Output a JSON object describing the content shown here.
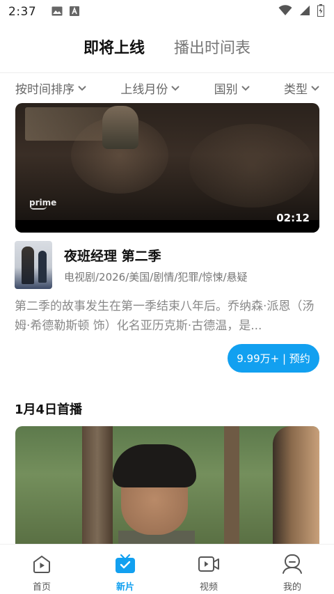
{
  "status_bar": {
    "time": "2:37",
    "icons_left": [
      "image-icon",
      "a-notification-icon"
    ],
    "icons_right": [
      "wifi-icon",
      "signal-icon",
      "battery-icon"
    ]
  },
  "top_tabs": [
    {
      "label": "即将上线",
      "active": true
    },
    {
      "label": "播出时间表",
      "active": false
    }
  ],
  "filters": [
    {
      "label": "按时间排序"
    },
    {
      "label": "上线月份"
    },
    {
      "label": "国别"
    },
    {
      "label": "类型"
    }
  ],
  "video1": {
    "duration": "02:12",
    "watermark": "prime"
  },
  "show": {
    "title": "夜班经理 第二季",
    "meta": "电视剧/2026/美国/剧情/犯罪/惊悚/悬疑",
    "description": "第二季的故事发生在第一季结束八年后。乔纳森·派恩（汤姆·希德勒斯顿 饰）化名亚历克斯·古德温，是...",
    "reserve_label": "9.99万+ | 预约"
  },
  "section": {
    "date_heading": "1月4日首播"
  },
  "bottom_nav": [
    {
      "label": "首页",
      "icon": "home-play-icon",
      "active": false
    },
    {
      "label": "新片",
      "icon": "new-movie-tv-icon",
      "active": true
    },
    {
      "label": "视频",
      "icon": "video-camera-icon",
      "active": false
    },
    {
      "label": "我的",
      "icon": "profile-icon",
      "active": false
    }
  ],
  "colors": {
    "accent": "#12a0f0",
    "text_primary": "#111111",
    "text_secondary": "#888888"
  }
}
